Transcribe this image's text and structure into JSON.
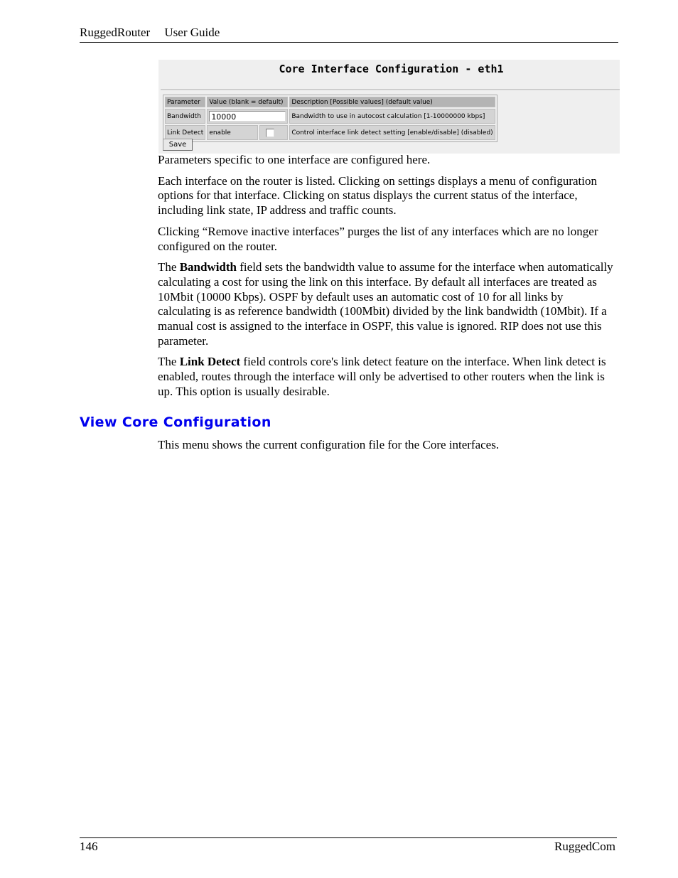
{
  "header": {
    "product": "RuggedRouter",
    "doc": "User Guide"
  },
  "footer": {
    "page_number": "146",
    "company": "RuggedCom"
  },
  "screenshot": {
    "title": "Core Interface Configuration - eth1",
    "table": {
      "headers": [
        "Parameter",
        "Value (blank = default)",
        "Description [Possible values] (default value)"
      ],
      "rows": [
        {
          "parameter": "Bandwidth",
          "value": "10000",
          "description": "Bandwidth to use in autocost calculation [1-10000000 kbps]"
        },
        {
          "parameter": "Link Detect",
          "value": "enable",
          "checked": false,
          "description": "Control interface link detect setting [enable/disable] (disabled)"
        }
      ]
    },
    "save_label": "Save"
  },
  "paragraphs": {
    "p1": "Parameters specific to one interface are configured here.",
    "p2": "Each interface on the router is listed.  Clicking on settings displays a menu of configuration options for that interface.  Clicking on status displays the current status of the interface, including link state, IP address and traffic counts.",
    "p3": "Clicking “Remove inactive interfaces” purges the list of any interfaces which are no longer configured on the router.",
    "p4": {
      "pre": "The ",
      "bold": "Bandwidth",
      "post": " field sets the bandwidth value to assume for the interface when automatically calculating a cost for using the link on this interface.  By default all interfaces are treated as 10Mbit (10000 Kbps).  OSPF by default uses an automatic cost of 10 for all links by calculating is as reference bandwidth (100Mbit) divided by the link bandwidth (10Mbit).  If a manual cost is assigned to the interface in OSPF, this value is ignored.  RIP does not use this parameter."
    },
    "p5": {
      "pre": "The ",
      "bold": "Link Detect",
      "post": " field controls core's link detect feature on the interface.  When link detect is enabled, routes through the interface will only be advertised to other routers when the link is up.  This option is usually desirable."
    }
  },
  "section": {
    "heading": "View Core Configuration",
    "text": "This menu shows the current configuration file for the Core interfaces."
  }
}
